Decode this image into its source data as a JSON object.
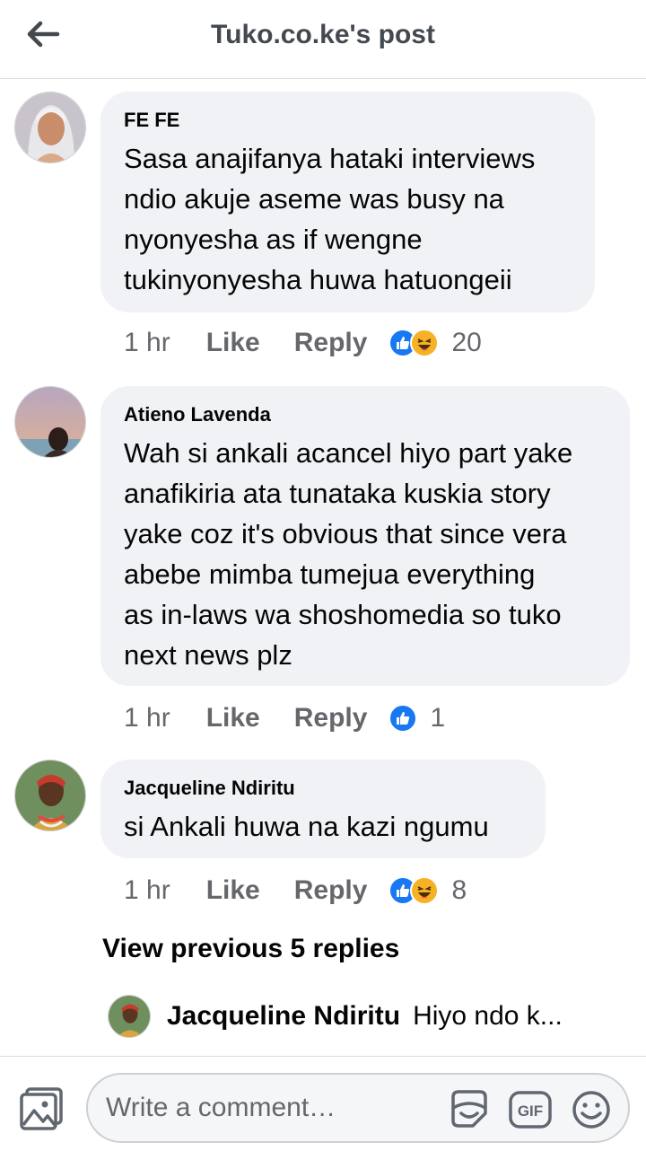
{
  "header": {
    "title": "Tuko.co.ke's post",
    "back_icon": "arrow-left-icon"
  },
  "comments": [
    {
      "author": "FE FE",
      "lines": [
        "Sasa anajifanya hataki interviews",
        "ndio akuje aseme was busy na",
        "nyonyesha as if wengne",
        "tukinyonyesha huwa hatuongeii"
      ],
      "time": "1 hr",
      "like_label": "Like",
      "reply_label": "Reply",
      "reactions": [
        "like",
        "haha"
      ],
      "reaction_count": "20"
    },
    {
      "author": "Atieno Lavenda",
      "lines": [
        "Wah si ankali acancel hiyo part yake",
        "anafikiria ata tunataka kuskia story",
        "yake coz it's obvious that since vera",
        "abebe mimba tumejua everything",
        "as in-laws wa shoshomedia so tuko",
        "next news plz"
      ],
      "time": "1 hr",
      "like_label": "Like",
      "reply_label": "Reply",
      "reactions": [
        "like"
      ],
      "reaction_count": "1"
    },
    {
      "author": "Jacqueline Ndiritu",
      "lines": [
        "si Ankali huwa na kazi ngumu"
      ],
      "time": "1 hr",
      "like_label": "Like",
      "reply_label": "Reply",
      "reactions": [
        "like",
        "haha"
      ],
      "reaction_count": "8"
    }
  ],
  "view_previous": "View previous 5 replies",
  "last_reply": {
    "author": "Jacqueline Ndiritu",
    "text": "Hiyo ndo k..."
  },
  "composer": {
    "placeholder": "Write a comment…",
    "icons": [
      "photo-icon",
      "sticker-icon",
      "gif-icon",
      "emoji-icon"
    ],
    "gif_label": "GIF"
  },
  "colors": {
    "like_blue": "#1877f2",
    "haha_yellow": "#f7b125",
    "bubble_bg": "#f0f2f5",
    "muted_text": "#65676b"
  }
}
